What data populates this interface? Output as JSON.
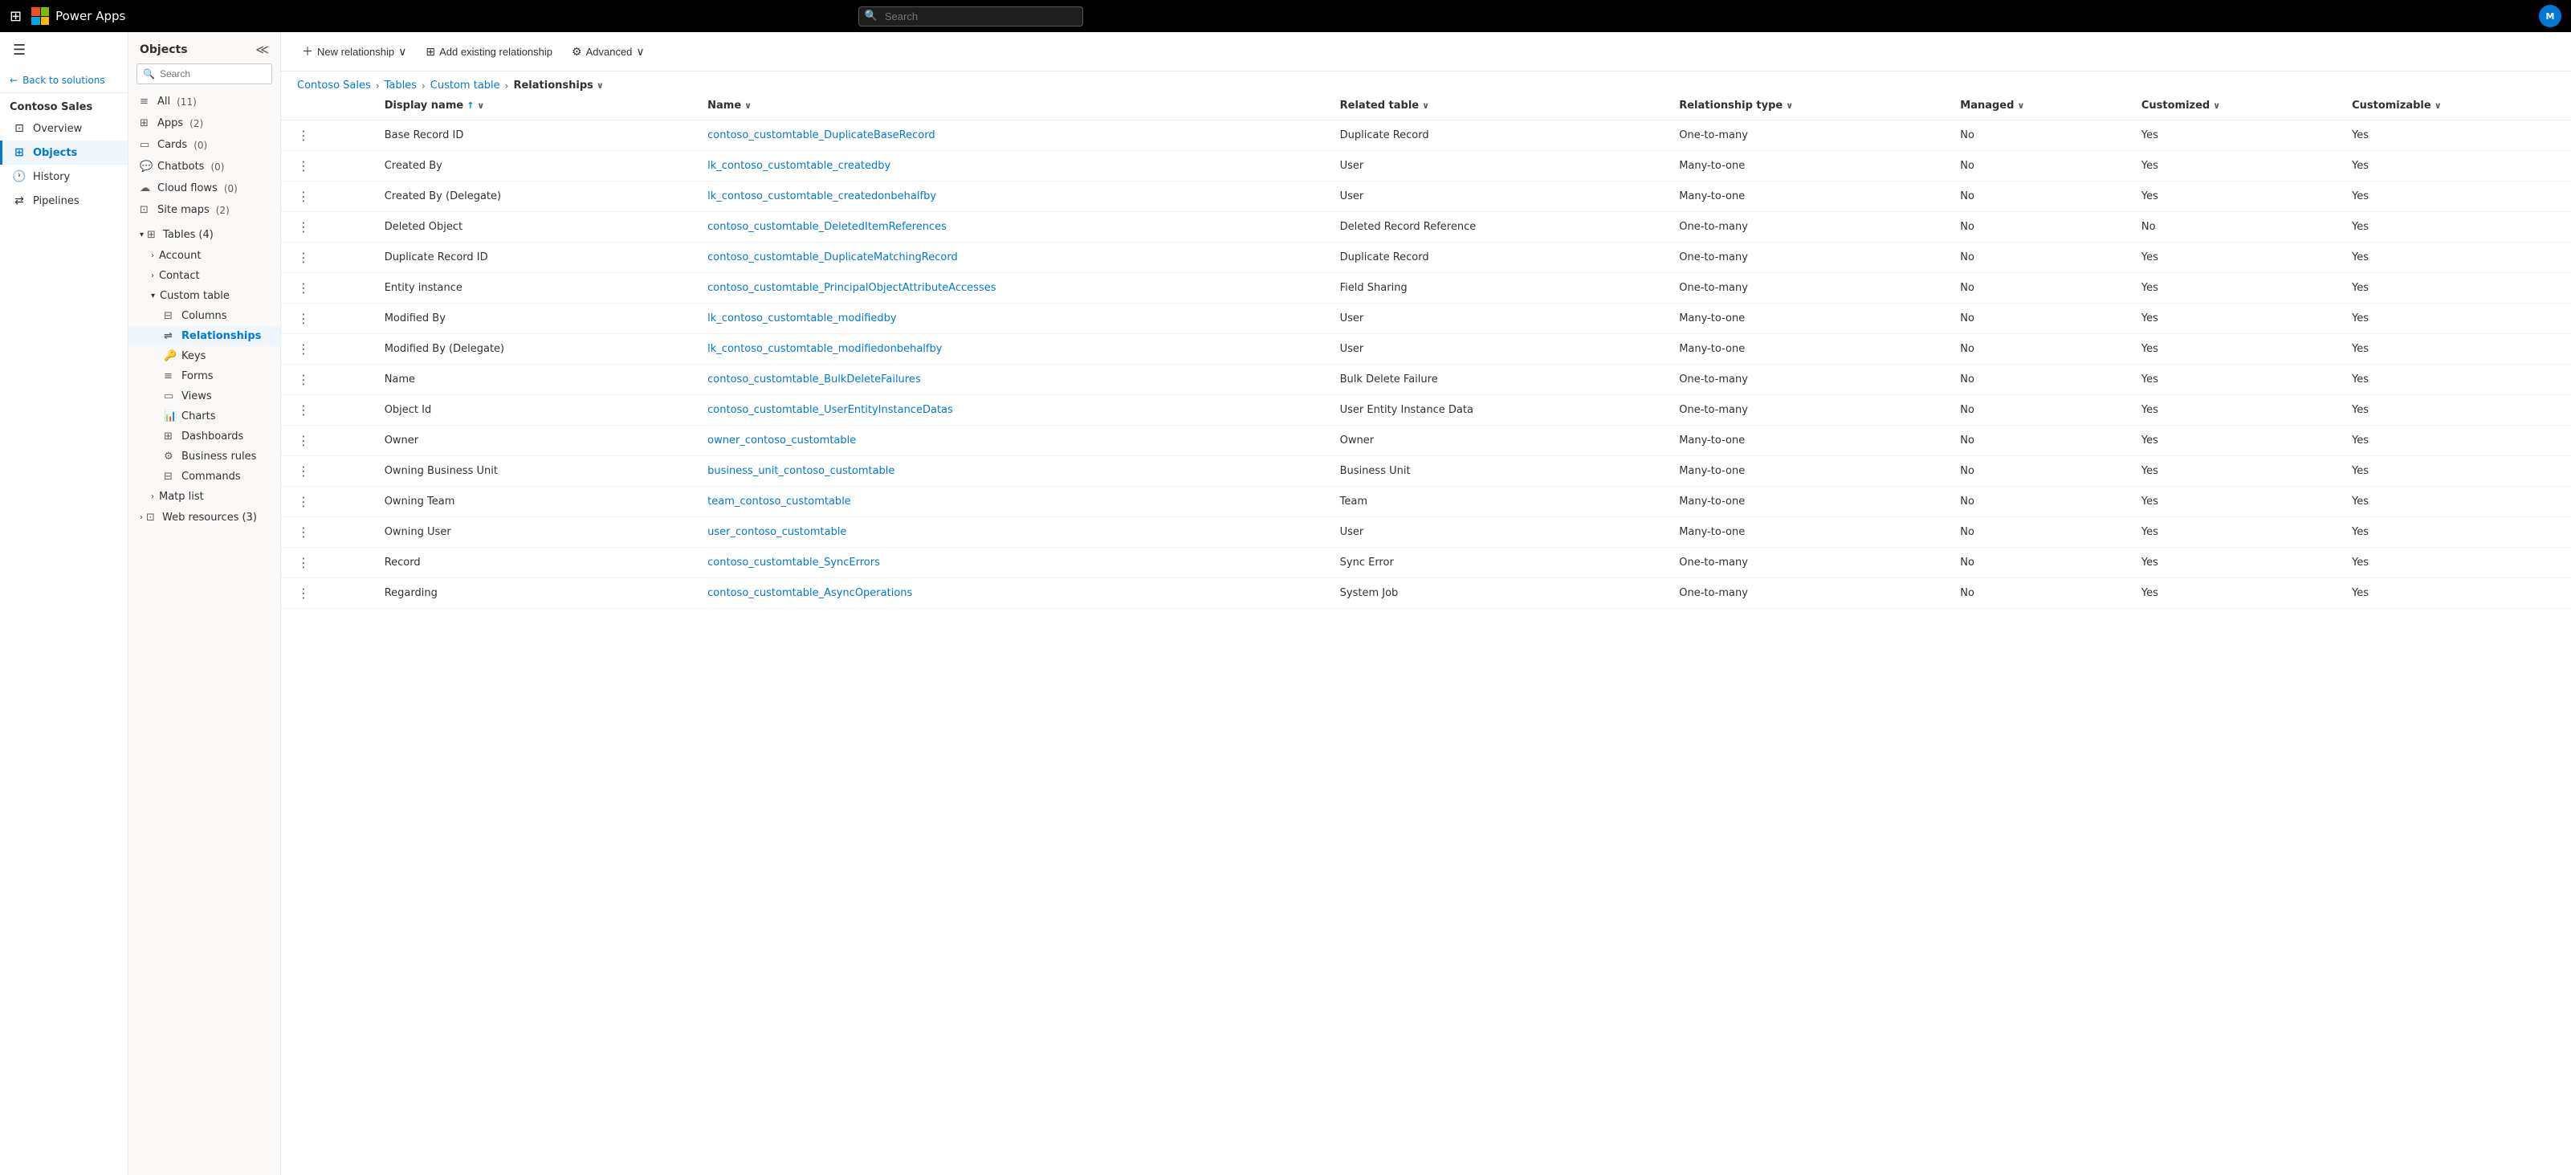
{
  "topbar": {
    "app_name": "Power Apps",
    "search_placeholder": "Search",
    "user_initials": "M"
  },
  "left_nav": {
    "back_label": "Back to solutions",
    "solution_name": "Contoso Sales",
    "items": [
      {
        "id": "overview",
        "label": "Overview",
        "icon": "⊡"
      },
      {
        "id": "objects",
        "label": "Objects",
        "icon": "⊞",
        "active": true
      },
      {
        "id": "history",
        "label": "History",
        "icon": "🕐"
      },
      {
        "id": "pipelines",
        "label": "Pipelines",
        "icon": "⇄"
      }
    ]
  },
  "middle_panel": {
    "title": "Objects",
    "search_placeholder": "Search",
    "items": [
      {
        "id": "all",
        "label": "All",
        "count": "(11)",
        "icon": "≡"
      },
      {
        "id": "apps",
        "label": "Apps",
        "count": "(2)",
        "icon": "⊞"
      },
      {
        "id": "cards",
        "label": "Cards",
        "count": "(0)",
        "icon": "▭"
      },
      {
        "id": "chatbots",
        "label": "Chatbots",
        "count": "(0)",
        "icon": "💬"
      },
      {
        "id": "cloud-flows",
        "label": "Cloud flows",
        "count": "(0)",
        "icon": "☁"
      },
      {
        "id": "site-maps",
        "label": "Site maps",
        "count": "(2)",
        "icon": "⊡"
      }
    ],
    "tables": {
      "label": "Tables",
      "count": "(4)",
      "expanded": true,
      "children": [
        {
          "id": "account",
          "label": "Account",
          "expanded": false
        },
        {
          "id": "contact",
          "label": "Contact",
          "expanded": false
        },
        {
          "id": "custom-table",
          "label": "Custom table",
          "expanded": true,
          "children": [
            {
              "id": "columns",
              "label": "Columns",
              "active": false
            },
            {
              "id": "relationships",
              "label": "Relationships",
              "active": true
            },
            {
              "id": "keys",
              "label": "Keys",
              "active": false
            },
            {
              "id": "forms",
              "label": "Forms",
              "active": false
            },
            {
              "id": "views",
              "label": "Views",
              "active": false
            },
            {
              "id": "charts",
              "label": "Charts",
              "active": false
            },
            {
              "id": "dashboards",
              "label": "Dashboards",
              "active": false
            },
            {
              "id": "business-rules",
              "label": "Business rules",
              "active": false
            },
            {
              "id": "commands",
              "label": "Commands",
              "active": false
            }
          ]
        },
        {
          "id": "matp-list",
          "label": "Matp list",
          "expanded": false
        }
      ]
    },
    "web_resources": {
      "label": "Web resources",
      "count": "(3)",
      "expanded": false
    }
  },
  "toolbar": {
    "new_relationship": "New relationship",
    "add_existing": "Add existing relationship",
    "advanced": "Advanced"
  },
  "breadcrumb": {
    "items": [
      "Contoso Sales",
      "Tables",
      "Custom table"
    ],
    "current": "Relationships"
  },
  "table": {
    "columns": [
      {
        "id": "display-name",
        "label": "Display name",
        "sorted": true,
        "sort_dir": "asc"
      },
      {
        "id": "name",
        "label": "Name",
        "sorted": false
      },
      {
        "id": "related-table",
        "label": "Related table",
        "sorted": false
      },
      {
        "id": "relationship-type",
        "label": "Relationship type",
        "sorted": false
      },
      {
        "id": "managed",
        "label": "Managed",
        "sorted": false
      },
      {
        "id": "customized",
        "label": "Customized",
        "sorted": false
      },
      {
        "id": "customizable",
        "label": "Customizable",
        "sorted": false
      }
    ],
    "rows": [
      {
        "display_name": "Base Record ID",
        "name": "contoso_customtable_DuplicateBaseRecord",
        "related_table": "Duplicate Record",
        "relationship_type": "One-to-many",
        "managed": "No",
        "customized": "Yes",
        "customizable": "Yes"
      },
      {
        "display_name": "Created By",
        "name": "lk_contoso_customtable_createdby",
        "related_table": "User",
        "relationship_type": "Many-to-one",
        "managed": "No",
        "customized": "Yes",
        "customizable": "Yes"
      },
      {
        "display_name": "Created By (Delegate)",
        "name": "lk_contoso_customtable_createdonbehalfby",
        "related_table": "User",
        "relationship_type": "Many-to-one",
        "managed": "No",
        "customized": "Yes",
        "customizable": "Yes"
      },
      {
        "display_name": "Deleted Object",
        "name": "contoso_customtable_DeletedItemReferences",
        "related_table": "Deleted Record Reference",
        "relationship_type": "One-to-many",
        "managed": "No",
        "customized": "No",
        "customizable": "Yes"
      },
      {
        "display_name": "Duplicate Record ID",
        "name": "contoso_customtable_DuplicateMatchingRecord",
        "related_table": "Duplicate Record",
        "relationship_type": "One-to-many",
        "managed": "No",
        "customized": "Yes",
        "customizable": "Yes"
      },
      {
        "display_name": "Entity instance",
        "name": "contoso_customtable_PrincipalObjectAttributeAccesses",
        "related_table": "Field Sharing",
        "relationship_type": "One-to-many",
        "managed": "No",
        "customized": "Yes",
        "customizable": "Yes"
      },
      {
        "display_name": "Modified By",
        "name": "lk_contoso_customtable_modifiedby",
        "related_table": "User",
        "relationship_type": "Many-to-one",
        "managed": "No",
        "customized": "Yes",
        "customizable": "Yes"
      },
      {
        "display_name": "Modified By (Delegate)",
        "name": "lk_contoso_customtable_modifiedonbehalfby",
        "related_table": "User",
        "relationship_type": "Many-to-one",
        "managed": "No",
        "customized": "Yes",
        "customizable": "Yes"
      },
      {
        "display_name": "Name",
        "name": "contoso_customtable_BulkDeleteFailures",
        "related_table": "Bulk Delete Failure",
        "relationship_type": "One-to-many",
        "managed": "No",
        "customized": "Yes",
        "customizable": "Yes"
      },
      {
        "display_name": "Object Id",
        "name": "contoso_customtable_UserEntityInstanceDatas",
        "related_table": "User Entity Instance Data",
        "relationship_type": "One-to-many",
        "managed": "No",
        "customized": "Yes",
        "customizable": "Yes"
      },
      {
        "display_name": "Owner",
        "name": "owner_contoso_customtable",
        "related_table": "Owner",
        "relationship_type": "Many-to-one",
        "managed": "No",
        "customized": "Yes",
        "customizable": "Yes"
      },
      {
        "display_name": "Owning Business Unit",
        "name": "business_unit_contoso_customtable",
        "related_table": "Business Unit",
        "relationship_type": "Many-to-one",
        "managed": "No",
        "customized": "Yes",
        "customizable": "Yes"
      },
      {
        "display_name": "Owning Team",
        "name": "team_contoso_customtable",
        "related_table": "Team",
        "relationship_type": "Many-to-one",
        "managed": "No",
        "customized": "Yes",
        "customizable": "Yes"
      },
      {
        "display_name": "Owning User",
        "name": "user_contoso_customtable",
        "related_table": "User",
        "relationship_type": "Many-to-one",
        "managed": "No",
        "customized": "Yes",
        "customizable": "Yes"
      },
      {
        "display_name": "Record",
        "name": "contoso_customtable_SyncErrors",
        "related_table": "Sync Error",
        "relationship_type": "One-to-many",
        "managed": "No",
        "customized": "Yes",
        "customizable": "Yes"
      },
      {
        "display_name": "Regarding",
        "name": "contoso_customtable_AsyncOperations",
        "related_table": "System Job",
        "relationship_type": "One-to-many",
        "managed": "No",
        "customized": "Yes",
        "customizable": "Yes"
      }
    ]
  }
}
